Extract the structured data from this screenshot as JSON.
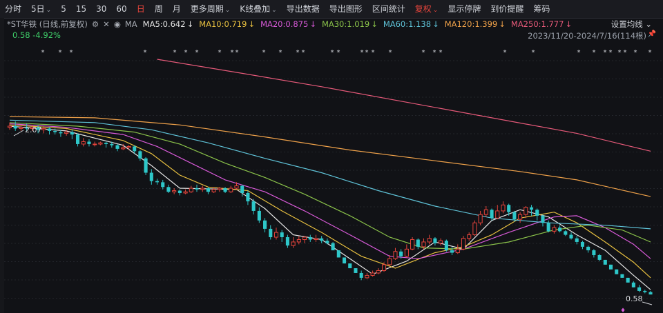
{
  "toolbar": {
    "items": [
      {
        "label": "分时",
        "caret": ""
      },
      {
        "label": "5日",
        "caret": "⌄"
      },
      {
        "label": "5",
        "caret": ""
      },
      {
        "label": "15",
        "caret": ""
      },
      {
        "label": "30",
        "caret": ""
      },
      {
        "label": "60",
        "caret": ""
      },
      {
        "label": "日",
        "caret": "",
        "active": true
      },
      {
        "label": "周",
        "caret": ""
      },
      {
        "label": "月",
        "caret": ""
      },
      {
        "label": "更多周期",
        "caret": "⌄"
      },
      {
        "label": "K线叠加",
        "caret": "⌄"
      },
      {
        "label": "导出数据",
        "caret": ""
      },
      {
        "label": "导出图形",
        "caret": ""
      },
      {
        "label": "区间统计",
        "caret": ""
      },
      {
        "label": "复权",
        "caret": "⌄",
        "active": true
      },
      {
        "label": "显示停牌",
        "caret": ""
      },
      {
        "label": "到价提醒",
        "caret": ""
      },
      {
        "label": "筹码",
        "caret": ""
      }
    ]
  },
  "legend": {
    "stock": "*ST华铁 (日线,前复权)",
    "icons": [
      "⚙",
      "✕",
      "◉"
    ],
    "ma_label": "MA",
    "ma": [
      {
        "label": "MA5:0.642",
        "arrow": "↓",
        "color": "#e6e6e6"
      },
      {
        "label": "MA10:0.719",
        "arrow": "↓",
        "color": "#e8c040"
      },
      {
        "label": "MA20:0.875",
        "arrow": "↓",
        "color": "#d85ad8"
      },
      {
        "label": "MA30:1.019",
        "arrow": "↓",
        "color": "#8bc34a"
      },
      {
        "label": "MA60:1.138",
        "arrow": "↓",
        "color": "#5fc3d8"
      },
      {
        "label": "MA120:1.399",
        "arrow": "↓",
        "color": "#f0a24a"
      },
      {
        "label": "MA250:1.777",
        "arrow": "↓",
        "color": "#e85a7a"
      }
    ],
    "settings": "设置均线 ⌄"
  },
  "info": {
    "price_change": "0.58  -4.92%",
    "range": "2023/11/20-2024/7/16(114根)",
    "pin_icon": "pin-icon"
  },
  "colors": {
    "up": "#e8453c",
    "down": "#2ec7c9",
    "background": "#111216"
  },
  "chart_data": {
    "type": "candlestick",
    "high_label": "2.07",
    "low_label": "0.58",
    "ylim": [
      0.5,
      2.55
    ],
    "candles": [
      [
        1.98,
        1.99,
        2.02,
        1.96
      ],
      [
        1.99,
        1.97,
        2.03,
        1.95
      ],
      [
        1.97,
        1.98,
        2.0,
        1.95
      ],
      [
        1.98,
        1.97,
        2.01,
        1.95
      ],
      [
        1.97,
        1.98,
        2.0,
        1.95
      ],
      [
        1.98,
        1.96,
        2.0,
        1.93
      ],
      [
        1.96,
        1.97,
        1.99,
        1.93
      ],
      [
        1.97,
        1.95,
        1.98,
        1.92
      ],
      [
        1.95,
        1.94,
        1.97,
        1.92
      ],
      [
        1.94,
        1.93,
        1.96,
        1.9
      ],
      [
        1.93,
        1.94,
        1.96,
        1.91
      ],
      [
        1.94,
        1.92,
        1.96,
        1.88
      ],
      [
        1.92,
        1.84,
        1.93,
        1.82
      ],
      [
        1.84,
        1.86,
        1.89,
        1.82
      ],
      [
        1.86,
        1.84,
        1.88,
        1.82
      ],
      [
        1.84,
        1.84,
        1.86,
        1.82
      ],
      [
        1.84,
        1.85,
        1.86,
        1.83
      ],
      [
        1.85,
        1.84,
        1.86,
        1.81
      ],
      [
        1.84,
        1.83,
        1.86,
        1.81
      ],
      [
        1.83,
        1.8,
        1.84,
        1.78
      ],
      [
        1.8,
        1.81,
        1.84,
        1.79
      ],
      [
        1.81,
        1.82,
        1.83,
        1.79
      ],
      [
        1.82,
        1.78,
        1.83,
        1.76
      ],
      [
        1.78,
        1.72,
        1.79,
        1.7
      ],
      [
        1.72,
        1.6,
        1.73,
        1.58
      ],
      [
        1.6,
        1.53,
        1.63,
        1.5
      ],
      [
        1.53,
        1.52,
        1.55,
        1.5
      ],
      [
        1.52,
        1.48,
        1.54,
        1.46
      ],
      [
        1.48,
        1.44,
        1.5,
        1.43
      ],
      [
        1.44,
        1.45,
        1.47,
        1.42
      ],
      [
        1.45,
        1.43,
        1.46,
        1.41
      ],
      [
        1.43,
        1.44,
        1.46,
        1.42
      ],
      [
        1.44,
        1.47,
        1.49,
        1.43
      ],
      [
        1.47,
        1.46,
        1.5,
        1.44
      ],
      [
        1.46,
        1.47,
        1.49,
        1.44
      ],
      [
        1.47,
        1.44,
        1.48,
        1.42
      ],
      [
        1.44,
        1.46,
        1.48,
        1.43
      ],
      [
        1.46,
        1.47,
        1.48,
        1.44
      ],
      [
        1.47,
        1.44,
        1.48,
        1.43
      ],
      [
        1.44,
        1.47,
        1.49,
        1.43
      ],
      [
        1.47,
        1.49,
        1.52,
        1.46
      ],
      [
        1.49,
        1.43,
        1.5,
        1.4
      ],
      [
        1.43,
        1.36,
        1.45,
        1.33
      ],
      [
        1.36,
        1.28,
        1.38,
        1.25
      ],
      [
        1.28,
        1.2,
        1.31,
        1.18
      ],
      [
        1.2,
        1.13,
        1.22,
        1.1
      ],
      [
        1.13,
        1.06,
        1.16,
        1.04
      ],
      [
        1.06,
        1.1,
        1.14,
        1.04
      ],
      [
        1.1,
        1.06,
        1.12,
        1.02
      ],
      [
        1.06,
        0.99,
        1.08,
        0.97
      ],
      [
        0.99,
        1.02,
        1.06,
        0.97
      ],
      [
        1.02,
        1.04,
        1.07,
        1.0
      ],
      [
        1.04,
        1.06,
        1.07,
        1.01
      ],
      [
        1.06,
        1.04,
        1.08,
        1.02
      ],
      [
        1.04,
        1.05,
        1.08,
        1.02
      ],
      [
        1.05,
        1.03,
        1.07,
        1.01
      ],
      [
        1.03,
        1.01,
        1.05,
        1.0
      ],
      [
        1.01,
        0.95,
        1.02,
        0.95
      ],
      [
        0.95,
        0.89,
        0.95,
        0.89
      ],
      [
        0.89,
        0.84,
        0.89,
        0.84
      ],
      [
        0.84,
        0.8,
        0.84,
        0.8
      ],
      [
        0.8,
        0.76,
        0.8,
        0.76
      ],
      [
        0.76,
        0.72,
        0.78,
        0.7
      ],
      [
        0.72,
        0.74,
        0.76,
        0.71
      ],
      [
        0.74,
        0.76,
        0.78,
        0.73
      ],
      [
        0.76,
        0.78,
        0.8,
        0.75
      ],
      [
        0.78,
        0.83,
        0.85,
        0.77
      ],
      [
        0.83,
        0.88,
        0.91,
        0.82
      ],
      [
        0.88,
        0.94,
        0.97,
        0.87
      ],
      [
        0.94,
        0.9,
        0.96,
        0.88
      ],
      [
        0.9,
        0.96,
        1.0,
        0.89
      ],
      [
        0.96,
        1.04,
        1.06,
        0.95
      ],
      [
        1.04,
        0.98,
        1.05,
        0.96
      ],
      [
        0.98,
        1.02,
        1.05,
        0.96
      ],
      [
        1.02,
        1.05,
        1.08,
        1.0
      ],
      [
        1.05,
        1.01,
        1.06,
        0.99
      ],
      [
        1.01,
        1.03,
        1.05,
        0.99
      ],
      [
        1.03,
        0.95,
        1.04,
        0.94
      ],
      [
        0.95,
        0.93,
        0.98,
        0.91
      ],
      [
        0.93,
        0.96,
        1.0,
        0.92
      ],
      [
        0.96,
        1.05,
        1.07,
        0.95
      ],
      [
        1.05,
        1.08,
        1.1,
        1.03
      ],
      [
        1.08,
        1.18,
        1.2,
        1.07
      ],
      [
        1.18,
        1.25,
        1.28,
        1.16
      ],
      [
        1.25,
        1.29,
        1.32,
        1.23
      ],
      [
        1.29,
        1.22,
        1.3,
        1.2
      ],
      [
        1.22,
        1.28,
        1.33,
        1.21
      ],
      [
        1.28,
        1.33,
        1.36,
        1.26
      ],
      [
        1.33,
        1.27,
        1.34,
        1.24
      ],
      [
        1.27,
        1.21,
        1.28,
        1.19
      ],
      [
        1.21,
        1.25,
        1.27,
        1.18
      ],
      [
        1.25,
        1.31,
        1.32,
        1.22
      ],
      [
        1.31,
        1.29,
        1.33,
        1.24
      ],
      [
        1.29,
        1.24,
        1.3,
        1.2
      ],
      [
        1.24,
        1.18,
        1.25,
        1.15
      ],
      [
        1.18,
        1.11,
        1.2,
        1.1
      ],
      [
        1.11,
        1.14,
        1.16,
        1.09
      ],
      [
        1.14,
        1.11,
        1.16,
        1.1
      ],
      [
        1.11,
        1.08,
        1.12,
        1.07
      ],
      [
        1.08,
        1.05,
        1.1,
        1.04
      ],
      [
        1.05,
        1.02,
        1.07,
        1.0
      ],
      [
        1.02,
        0.98,
        1.03,
        0.96
      ],
      [
        0.98,
        0.95,
        0.99,
        0.93
      ],
      [
        0.95,
        0.91,
        0.96,
        0.89
      ],
      [
        0.91,
        0.87,
        0.92,
        0.86
      ],
      [
        0.87,
        0.83,
        0.87,
        0.83
      ],
      [
        0.83,
        0.79,
        0.83,
        0.79
      ],
      [
        0.79,
        0.75,
        0.79,
        0.75
      ],
      [
        0.75,
        0.72,
        0.75,
        0.72
      ],
      [
        0.72,
        0.68,
        0.72,
        0.68
      ],
      [
        0.68,
        0.64,
        0.69,
        0.64
      ],
      [
        0.64,
        0.61,
        0.66,
        0.6
      ],
      [
        0.61,
        0.6,
        0.62,
        0.59
      ],
      [
        0.6,
        0.58,
        0.61,
        0.58
      ]
    ],
    "ma_lines": [
      {
        "name": "MA5",
        "color": "#e6e6e6",
        "points": [
          [
            0,
            1.99
          ],
          [
            10,
            1.95
          ],
          [
            20,
            1.83
          ],
          [
            25,
            1.66
          ],
          [
            30,
            1.47
          ],
          [
            40,
            1.46
          ],
          [
            45,
            1.3
          ],
          [
            50,
            1.08
          ],
          [
            55,
            1.04
          ],
          [
            60,
            0.88
          ],
          [
            64,
            0.75
          ],
          [
            70,
            0.86
          ],
          [
            75,
            1.02
          ],
          [
            80,
            0.96
          ],
          [
            85,
            1.2
          ],
          [
            90,
            1.29
          ],
          [
            95,
            1.23
          ],
          [
            100,
            1.08
          ],
          [
            105,
            0.95
          ],
          [
            110,
            0.74
          ],
          [
            113,
            0.62
          ]
        ]
      },
      {
        "name": "MA10",
        "color": "#e8c040",
        "points": [
          [
            0,
            2.0
          ],
          [
            10,
            1.97
          ],
          [
            20,
            1.87
          ],
          [
            25,
            1.76
          ],
          [
            30,
            1.58
          ],
          [
            35,
            1.48
          ],
          [
            42,
            1.45
          ],
          [
            48,
            1.28
          ],
          [
            55,
            1.1
          ],
          [
            62,
            0.9
          ],
          [
            68,
            0.8
          ],
          [
            75,
            0.93
          ],
          [
            80,
            0.98
          ],
          [
            85,
            1.08
          ],
          [
            90,
            1.22
          ],
          [
            96,
            1.27
          ],
          [
            100,
            1.18
          ],
          [
            105,
            1.02
          ],
          [
            110,
            0.85
          ],
          [
            113,
            0.72
          ]
        ]
      },
      {
        "name": "MA20",
        "color": "#d85ad8",
        "points": [
          [
            0,
            2.01
          ],
          [
            10,
            1.98
          ],
          [
            20,
            1.92
          ],
          [
            26,
            1.82
          ],
          [
            32,
            1.68
          ],
          [
            38,
            1.54
          ],
          [
            45,
            1.44
          ],
          [
            52,
            1.28
          ],
          [
            60,
            1.08
          ],
          [
            67,
            0.9
          ],
          [
            72,
            0.88
          ],
          [
            80,
            0.96
          ],
          [
            88,
            1.1
          ],
          [
            96,
            1.23
          ],
          [
            100,
            1.24
          ],
          [
            105,
            1.14
          ],
          [
            110,
            1.0
          ],
          [
            113,
            0.88
          ]
        ]
      },
      {
        "name": "MA30",
        "color": "#8bc34a",
        "points": [
          [
            0,
            2.02
          ],
          [
            12,
            1.99
          ],
          [
            22,
            1.94
          ],
          [
            30,
            1.84
          ],
          [
            38,
            1.68
          ],
          [
            45,
            1.56
          ],
          [
            52,
            1.42
          ],
          [
            60,
            1.24
          ],
          [
            67,
            1.06
          ],
          [
            73,
            0.97
          ],
          [
            80,
            0.96
          ],
          [
            88,
            1.02
          ],
          [
            96,
            1.12
          ],
          [
            102,
            1.16
          ],
          [
            108,
            1.12
          ],
          [
            113,
            1.02
          ]
        ]
      },
      {
        "name": "MA60",
        "color": "#5fc3d8",
        "points": [
          [
            0,
            2.04
          ],
          [
            15,
            2.02
          ],
          [
            25,
            1.96
          ],
          [
            35,
            1.85
          ],
          [
            45,
            1.72
          ],
          [
            55,
            1.6
          ],
          [
            65,
            1.45
          ],
          [
            75,
            1.32
          ],
          [
            85,
            1.22
          ],
          [
            95,
            1.18
          ],
          [
            105,
            1.16
          ],
          [
            113,
            1.13
          ]
        ]
      },
      {
        "name": "MA120",
        "color": "#f0a24a",
        "points": [
          [
            0,
            2.07
          ],
          [
            15,
            2.06
          ],
          [
            30,
            2.0
          ],
          [
            45,
            1.9
          ],
          [
            60,
            1.79
          ],
          [
            75,
            1.7
          ],
          [
            90,
            1.61
          ],
          [
            100,
            1.54
          ],
          [
            113,
            1.4
          ]
        ]
      },
      {
        "name": "MA250",
        "color": "#e85a7a",
        "points": [
          [
            26,
            2.55
          ],
          [
            40,
            2.44
          ],
          [
            55,
            2.32
          ],
          [
            70,
            2.19
          ],
          [
            85,
            2.06
          ],
          [
            100,
            1.93
          ],
          [
            113,
            1.78
          ]
        ]
      }
    ]
  }
}
